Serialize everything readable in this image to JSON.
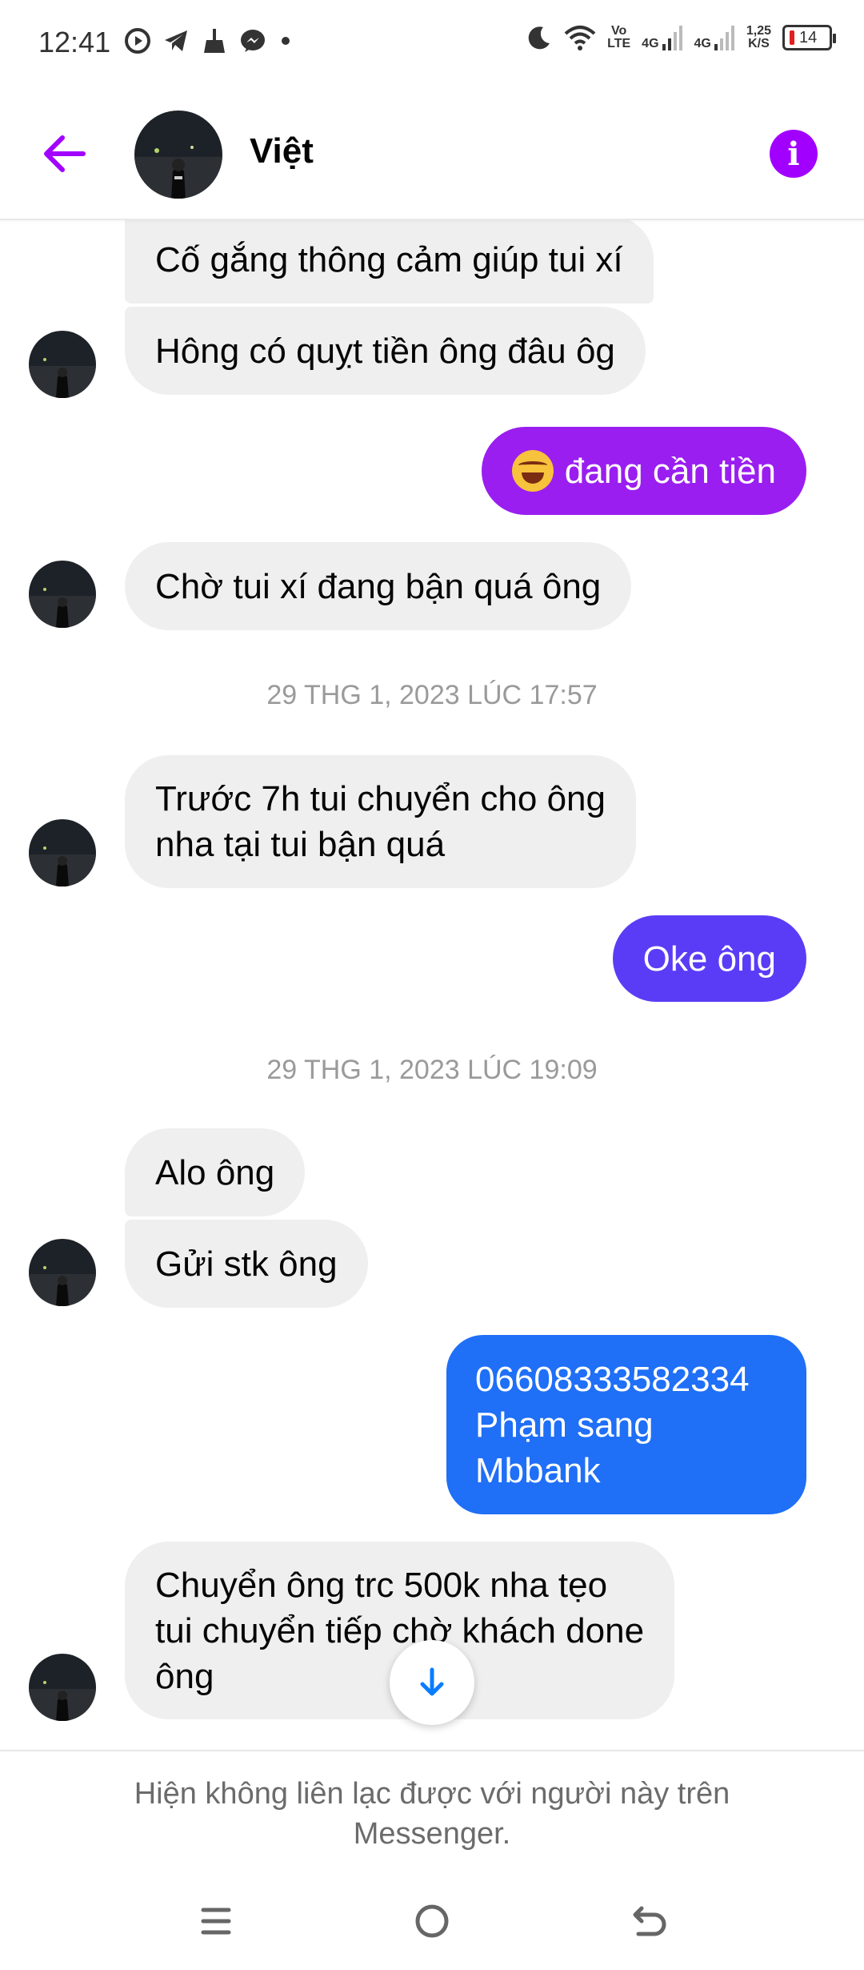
{
  "status_bar": {
    "time": "12:41",
    "network_1": "Vo\nLTE",
    "net_4g_a": "4G",
    "net_4g_b": "4G",
    "speed": "1,25\nK/S",
    "battery": "14",
    "icons": [
      "play-circle-icon",
      "telegram-icon",
      "broom-icon",
      "messenger-icon",
      "dot-icon",
      "moon-icon",
      "wifi-icon",
      "signal-icon",
      "battery-icon"
    ]
  },
  "header": {
    "contact_name": "Việt",
    "accent_color": "#a100ff"
  },
  "messages": [
    {
      "side": "in",
      "text": "Cố gắng thông cảm giúp tui xí"
    },
    {
      "side": "in",
      "text": "Hông có quỵt tiền ông đâu ôg"
    },
    {
      "side": "out",
      "text": "đang cần tiền",
      "emoji": "rolling-on-floor-laughing-emoji",
      "color": "#9a1ef0"
    },
    {
      "side": "in",
      "text": "Chờ tui xí đang bận quá ông"
    },
    {
      "side": "timestamp",
      "text": "29 THG 1, 2023 LÚC 17:57"
    },
    {
      "side": "in",
      "text": "Trước 7h tui chuyển cho ông\nnha tại tui bận quá"
    },
    {
      "side": "out",
      "text": "Oke ông",
      "color": "#5b3cf6"
    },
    {
      "side": "timestamp",
      "text": "29 THG 1, 2023 LÚC 19:09"
    },
    {
      "side": "in",
      "text": "Alo ông"
    },
    {
      "side": "in",
      "text": "Gửi stk ông"
    },
    {
      "side": "out",
      "text": "06608333582334\nPhạm sang\nMbbank",
      "color": "#1f6ff7"
    },
    {
      "side": "in",
      "text": "Chuyển ông trc 500k nha tẹo\ntui chuyển tiếp chờ khách done\nông"
    }
  ],
  "footer": {
    "notice": "Hiện không liên lạc được với người này trên\nMessenger."
  },
  "nav": [
    "menu-icon",
    "home-circle-icon",
    "back-icon"
  ]
}
